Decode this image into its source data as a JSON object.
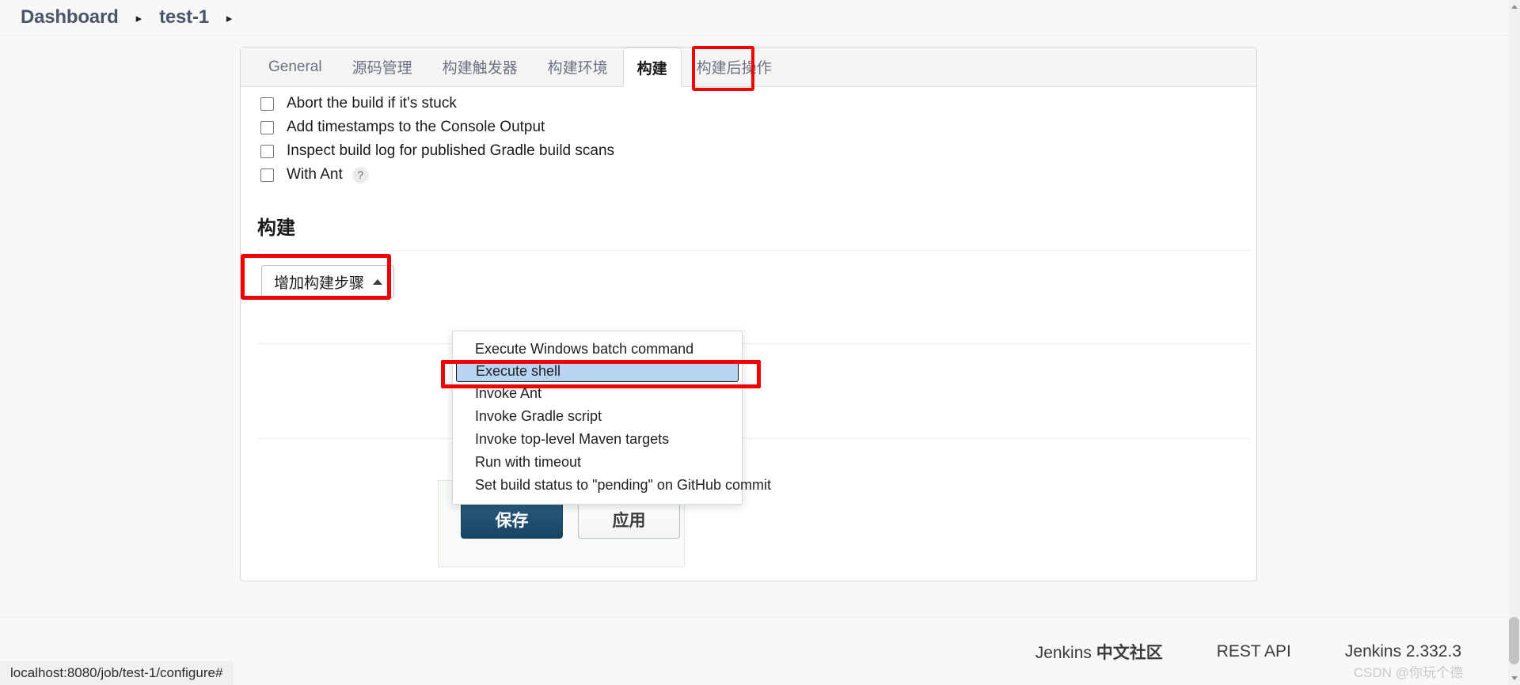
{
  "breadcrumb": {
    "items": [
      {
        "label": "Dashboard"
      },
      {
        "label": "test-1"
      }
    ],
    "separator": "▸"
  },
  "tabs": [
    {
      "label": "General",
      "active": false
    },
    {
      "label": "源码管理",
      "active": false
    },
    {
      "label": "构建触发器",
      "active": false
    },
    {
      "label": "构建环境",
      "active": false
    },
    {
      "label": "构建",
      "active": true
    },
    {
      "label": "构建后操作",
      "active": false
    }
  ],
  "options": [
    {
      "label": "Abort the build if it's stuck",
      "checked": false,
      "help": false
    },
    {
      "label": "Add timestamps to the Console Output",
      "checked": false,
      "help": false
    },
    {
      "label": "Inspect build log for published Gradle build scans",
      "checked": false,
      "help": false
    },
    {
      "label": "With Ant",
      "checked": false,
      "help": true,
      "help_glyph": "?"
    }
  ],
  "build_section": {
    "title": "构建",
    "add_step_button": "增加构建步骤",
    "chevron": "up"
  },
  "dropdown": {
    "items": [
      {
        "label": "Execute Windows batch command",
        "selected": false
      },
      {
        "label": "Execute shell",
        "selected": true
      },
      {
        "label": "Invoke Ant",
        "selected": false
      },
      {
        "label": "Invoke Gradle script",
        "selected": false
      },
      {
        "label": "Invoke top-level Maven targets",
        "selected": false
      },
      {
        "label": "Run with timeout",
        "selected": false
      },
      {
        "label": "Set build status to \"pending\" on GitHub commit",
        "selected": false
      }
    ]
  },
  "form_buttons": {
    "save": "保存",
    "apply": "应用"
  },
  "footer": {
    "links": [
      {
        "label_plain": "Jenkins ",
        "label_bold": "中文社区"
      },
      {
        "label_plain": "REST API",
        "label_bold": ""
      },
      {
        "label_plain": "Jenkins 2.332.3",
        "label_bold": ""
      }
    ],
    "watermark": "CSDN @你玩个德"
  },
  "statusbar": {
    "url": "localhost:8080/job/test-1/configure#"
  },
  "colors": {
    "annotation_red": "#f50000",
    "save_button": "#174663",
    "selected_item": "#b9d3f3",
    "accent_text": "#4a5568"
  }
}
